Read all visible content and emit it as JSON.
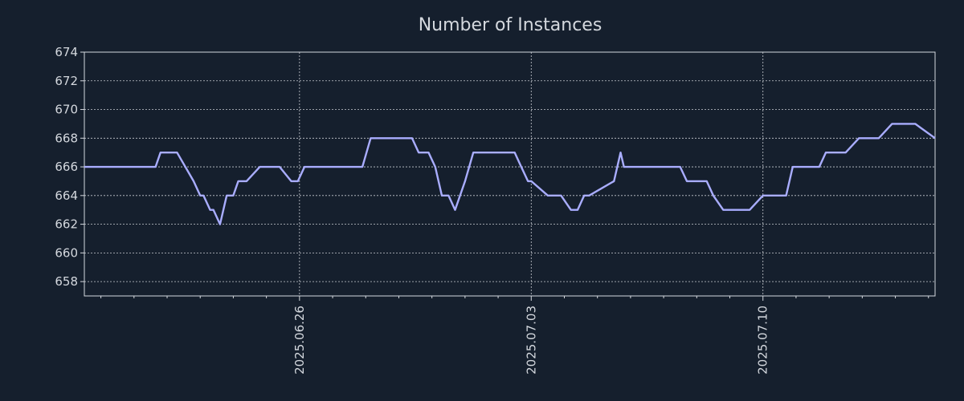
{
  "chart_data": {
    "type": "line",
    "title": "Number of Instances",
    "xlabel": "",
    "ylabel": "",
    "x_ticks": [
      "2025.06.26",
      "2025.07.03",
      "2025.07.10"
    ],
    "y_ticks": [
      658,
      660,
      662,
      664,
      666,
      668,
      670,
      672,
      674
    ],
    "ylim": [
      657,
      674
    ],
    "grid": true,
    "x_range_days": [
      -6.5,
      19.2
    ],
    "x_tick_positions": [
      0,
      7,
      14
    ],
    "series": [
      {
        "color": "#a9adff",
        "x": [
          -6.5,
          -4.35,
          -4.2,
          -3.7,
          -3.2,
          -3.0,
          -2.9,
          -2.7,
          -2.6,
          -2.4,
          -2.2,
          -2.0,
          -1.85,
          -1.6,
          -1.2,
          -1.05,
          -0.6,
          -0.25,
          -0.05,
          0.15,
          1.9,
          2.15,
          3.4,
          3.6,
          3.9,
          4.1,
          4.3,
          4.5,
          4.7,
          5.0,
          5.25,
          6.5,
          6.7,
          6.9,
          7.0,
          7.5,
          7.7,
          7.9,
          8.2,
          8.4,
          8.6,
          8.75,
          9.5,
          9.7,
          9.8,
          10.1,
          10.35,
          10.7,
          11.5,
          11.7,
          11.9,
          12.3,
          12.5,
          12.8,
          13.2,
          13.4,
          13.6,
          14.0,
          14.7,
          14.9,
          15.7,
          15.9,
          16.1,
          16.3,
          16.5,
          16.9,
          17.1,
          17.5,
          17.9,
          18.1,
          18.4,
          18.6,
          19.2
        ],
        "y": [
          666,
          666,
          667,
          667,
          665,
          664,
          664,
          663,
          663,
          662,
          664,
          664,
          665,
          665,
          666,
          666,
          666,
          665,
          665,
          666,
          666,
          668,
          668,
          667,
          667,
          666,
          664,
          664,
          663,
          665,
          667,
          667,
          666,
          665,
          665,
          664,
          664,
          664,
          663,
          663,
          664,
          664,
          665,
          667,
          666,
          666,
          666,
          666,
          666,
          665,
          665,
          665,
          664,
          663,
          663,
          663,
          663,
          664,
          664,
          666,
          666,
          667,
          667,
          667,
          667,
          668,
          668,
          668,
          669,
          669,
          669,
          669,
          668
        ]
      }
    ]
  }
}
